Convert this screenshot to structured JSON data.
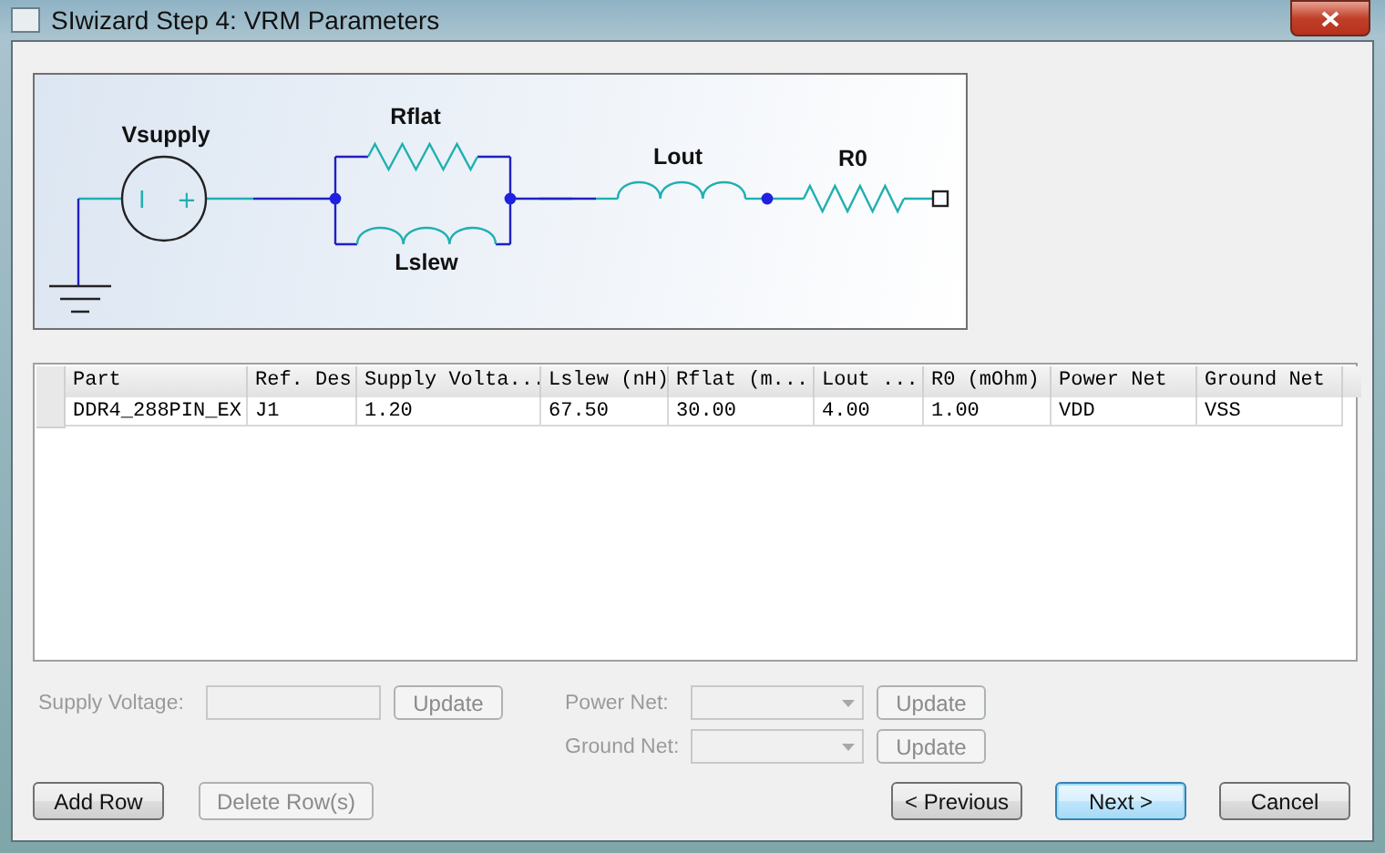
{
  "window": {
    "title": "SIwizard Step 4: VRM Parameters"
  },
  "schematic": {
    "labels": [
      {
        "kind": "source",
        "text": "Vsupply"
      },
      {
        "kind": "rflat",
        "text": "Rflat"
      },
      {
        "kind": "lslew",
        "text": "Lslew"
      },
      {
        "kind": "lout",
        "text": "Lout"
      },
      {
        "kind": "r0",
        "text": "R0"
      }
    ],
    "source_minus": "I",
    "source_plus": "+"
  },
  "table": {
    "columns": [
      "Part",
      "Ref. Des",
      "Supply Volta...",
      "Lslew (nH)",
      "Rflat (m...",
      "Lout ...",
      "R0 (mOhm)",
      "Power Net",
      "Ground Net"
    ],
    "rows": [
      {
        "cells": [
          "DDR4_288PIN_EX",
          "J1",
          "1.20",
          "67.50",
          "30.00",
          "4.00",
          "1.00",
          "VDD",
          "VSS"
        ],
        "selected": false
      }
    ]
  },
  "editors": [
    {
      "kind": "text",
      "label": "Supply Voltage:",
      "button": "Update",
      "disabled": true
    },
    {
      "kind": "combo",
      "label": "Power Net:",
      "button": "Update",
      "disabled": true
    },
    {
      "kind": "combo",
      "label": "Ground Net:",
      "button": "Update",
      "disabled": true
    }
  ],
  "row_buttons": [
    {
      "label": "Add Row",
      "disabled": false,
      "default": false
    },
    {
      "label": "Delete Row(s)",
      "disabled": true,
      "default": false
    }
  ],
  "nav_buttons": [
    {
      "label": "< Previous",
      "disabled": false,
      "default": false
    },
    {
      "label": "Next >",
      "disabled": false,
      "default": true
    },
    {
      "label": "Cancel",
      "disabled": false,
      "default": false
    }
  ]
}
